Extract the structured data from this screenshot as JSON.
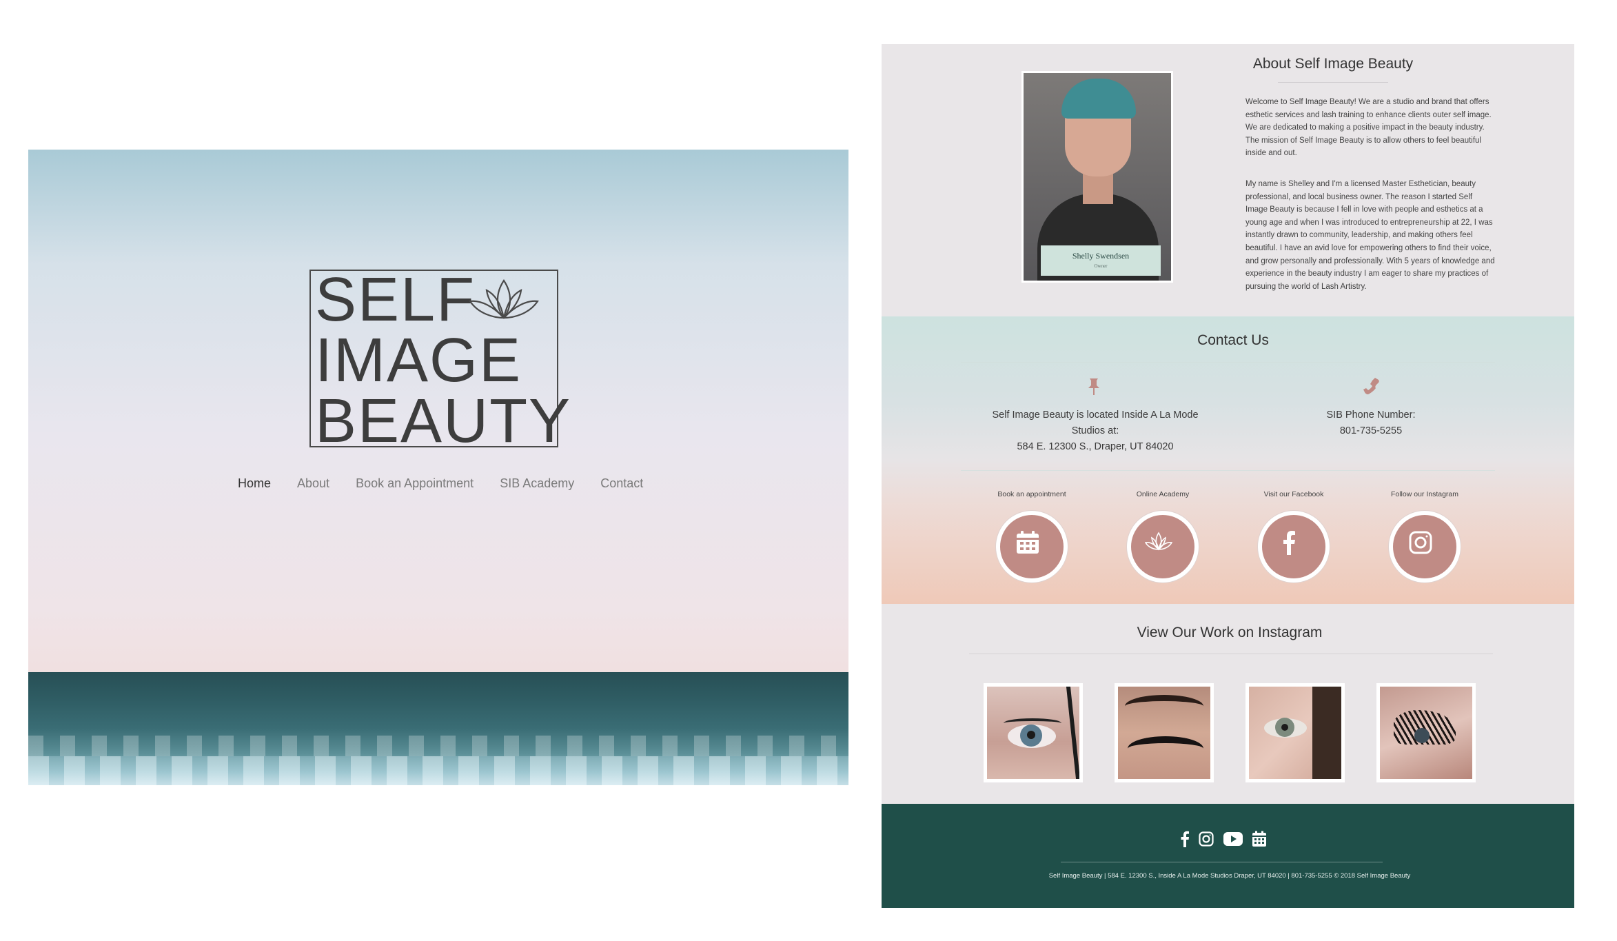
{
  "hero": {
    "logo": {
      "line1": "SELF",
      "line2": "IMAGE",
      "line3": "BEAUTY"
    },
    "nav": [
      {
        "label": "Home",
        "active": true
      },
      {
        "label": "About",
        "active": false
      },
      {
        "label": "Book an Appointment",
        "active": false
      },
      {
        "label": "SIB Academy",
        "active": false
      },
      {
        "label": "Contact",
        "active": false
      }
    ]
  },
  "about": {
    "title": "About Self Image Beauty",
    "portrait": {
      "name": "Shelly Swendsen",
      "role": "Owner"
    },
    "paragraphs": [
      "Welcome to Self Image Beauty! We are a studio and brand that offers esthetic services and lash training to enhance clients outer self image. We are dedicated to making a positive impact in the beauty industry. The mission of Self Image Beauty is to allow others to feel beautiful inside and out.",
      "My name is Shelley and I'm a licensed Master Esthetician, beauty professional, and local business owner. The reason I started Self Image Beauty is because I fell in love with people and esthetics at a young age and when I was introduced to entrepreneurship at 22, I was instantly drawn to community, leadership, and making others feel beautiful. I have an avid love for empowering others to find their voice, and grow personally and professionally. With 5 years of knowledge and experience in the beauty industry I am eager to share my practices of pursuing the world of Lash Artistry."
    ]
  },
  "contact": {
    "title": "Contact Us",
    "location": {
      "icon": "pushpin-icon",
      "line1": "Self Image Beauty is located Inside A La Mode",
      "line2": "Studios at:",
      "line3": "584 E. 12300 S., Draper, UT 84020"
    },
    "phone": {
      "icon": "phone-icon",
      "line1": "SIB Phone Number:",
      "line2": "801-735-5255"
    },
    "links": [
      {
        "label": "Book an appointment",
        "icon": "calendar-icon"
      },
      {
        "label": "Online Academy",
        "icon": "lotus-icon"
      },
      {
        "label": "Visit our Facebook",
        "icon": "facebook-icon"
      },
      {
        "label": "Follow our Instagram",
        "icon": "instagram-icon"
      }
    ]
  },
  "instagram": {
    "title": "View Our Work on Instagram"
  },
  "footer": {
    "icons": [
      "facebook-icon",
      "instagram-icon",
      "youtube-icon",
      "calendar-icon"
    ],
    "text": "Self Image Beauty | 584 E. 12300 S., Inside A La Mode Studios Draper, UT 84020 | 801-735-5255 © 2018 Self Image Beauty"
  },
  "colors": {
    "accent": "#c08b85",
    "footer": "#1f4f49",
    "nameplate": "#cfe3dc"
  }
}
